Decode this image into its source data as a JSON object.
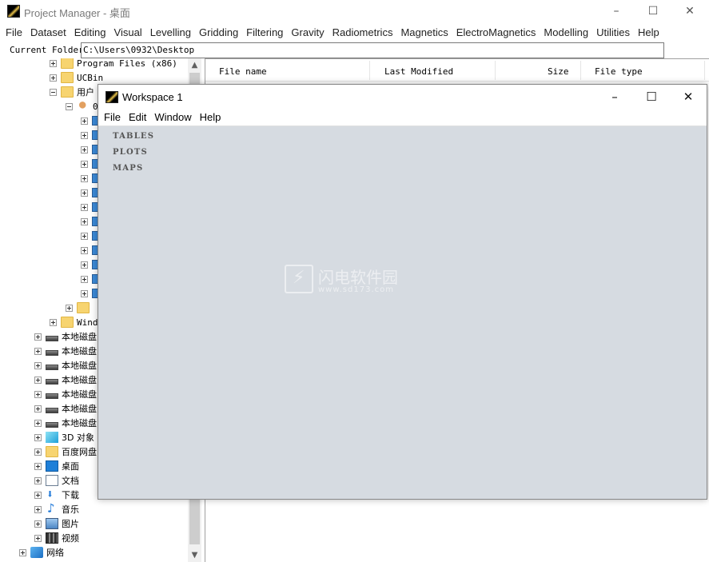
{
  "app": {
    "title": "Project Manager - 桌面"
  },
  "window_controls": {
    "minimize": "–",
    "maximize": "☐",
    "close": "✕"
  },
  "menu": [
    "File",
    "Dataset",
    "Editing",
    "Visual",
    "Levelling",
    "Gridding",
    "Filtering",
    "Gravity",
    "Radiometrics",
    "Magnetics",
    "ElectroMagnetics",
    "Modelling",
    "Utilities",
    "Help"
  ],
  "folder": {
    "label": "Current Folder",
    "value": "C:\\Users\\0932\\Desktop"
  },
  "tree": {
    "items": [
      {
        "label": "Program Files (x86)",
        "icon": "folder-icon"
      },
      {
        "label": "UCBin",
        "icon": "folder-icon"
      },
      {
        "label": "用户",
        "icon": "folder-icon"
      },
      {
        "label": "0",
        "icon": "user-icon"
      },
      {
        "label": "Wind",
        "icon": "folder-icon"
      },
      {
        "label": "本地磁盘",
        "icon": "drive-icon"
      },
      {
        "label": "本地磁盘",
        "icon": "drive-icon"
      },
      {
        "label": "本地磁盘",
        "icon": "drive-icon"
      },
      {
        "label": "本地磁盘",
        "icon": "drive-icon"
      },
      {
        "label": "本地磁盘",
        "icon": "drive-icon"
      },
      {
        "label": "本地磁盘",
        "icon": "drive-icon"
      },
      {
        "label": "本地磁盘",
        "icon": "drive-icon"
      },
      {
        "label": "3D 对象",
        "icon": "cube-icon"
      },
      {
        "label": "百度网盘",
        "icon": "folder-icon"
      },
      {
        "label": "桌面",
        "icon": "desktop-icon"
      },
      {
        "label": "文档",
        "icon": "document-icon"
      },
      {
        "label": "下载",
        "icon": "download-icon"
      },
      {
        "label": "音乐",
        "icon": "music-icon"
      },
      {
        "label": "图片",
        "icon": "picture-icon"
      },
      {
        "label": "视频",
        "icon": "video-icon"
      },
      {
        "label": "网络",
        "icon": "network-icon"
      }
    ]
  },
  "file_list": {
    "columns": [
      "File name",
      "Last Modified",
      "Size",
      "File type"
    ]
  },
  "workspace": {
    "title": "Workspace 1",
    "menu": [
      "File",
      "Edit",
      "Window",
      "Help"
    ],
    "sections": [
      "TABLES",
      "PLOTS",
      "MAPS"
    ]
  },
  "watermark": {
    "text": "闪电软件园",
    "url": "www.sd173.com"
  }
}
